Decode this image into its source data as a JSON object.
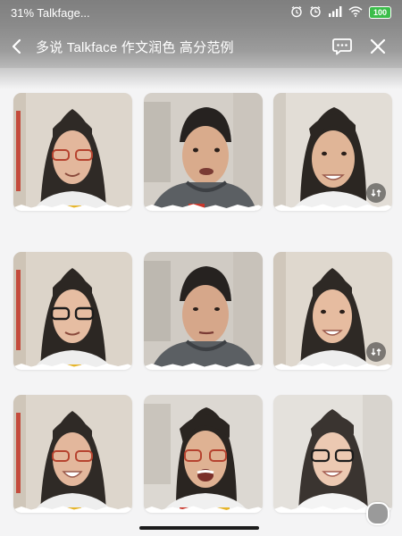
{
  "status_bar": {
    "left_text": "31% Talkfage...",
    "icons": [
      "alarm-icon",
      "clock-icon",
      "signal-icon",
      "wifi-icon",
      "battery-icon"
    ],
    "battery_label": "100"
  },
  "header": {
    "title": "多说 Talkface 作文润色 高分范例",
    "back_icon": "chevron-left-icon",
    "chat_icon": "chat-bubble-icon",
    "close_icon": "close-icon"
  },
  "grid": {
    "columns": 3,
    "rows": 3,
    "items": [
      {
        "id": "woman-red-glasses",
        "badge": false
      },
      {
        "id": "man-hoodie-talking",
        "badge": false
      },
      {
        "id": "man-smiling",
        "badge": true
      },
      {
        "id": "woman-black-glasses",
        "badge": false
      },
      {
        "id": "man-hoodie-serious",
        "badge": false
      },
      {
        "id": "woman-smiling",
        "badge": true
      },
      {
        "id": "woman-red-glasses-smiling",
        "badge": false
      },
      {
        "id": "man-red-glasses-laughing",
        "badge": false
      },
      {
        "id": "woman-black-glasses-smiling",
        "badge": false
      }
    ]
  },
  "colors": {
    "status_bg": "#808080",
    "page_bg": "#f4f4f5",
    "battery": "#3bbd4a",
    "card_wall": "#ddd8d2"
  }
}
